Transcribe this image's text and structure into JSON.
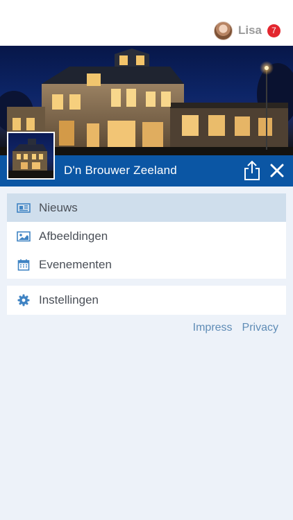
{
  "user": {
    "name": "Lisa",
    "notification_count": "7"
  },
  "venue": {
    "name": "D'n Brouwer Zeeland"
  },
  "menu": {
    "main": [
      {
        "label": "Nieuws",
        "icon": "newspaper-icon",
        "active": true
      },
      {
        "label": "Afbeeldingen",
        "icon": "image-icon",
        "active": false
      },
      {
        "label": "Evenementen",
        "icon": "calendar-icon",
        "active": false
      }
    ],
    "settings": {
      "label": "Instellingen",
      "icon": "gear-icon"
    }
  },
  "footer_links": {
    "impress": "Impress",
    "privacy": "Privacy"
  },
  "colors": {
    "accent": "#0b56a4",
    "active_row": "#cfdeec",
    "background": "#edf2f9",
    "icon": "#3f83c3",
    "badge": "#e3262e",
    "link": "#5f8cb6"
  }
}
